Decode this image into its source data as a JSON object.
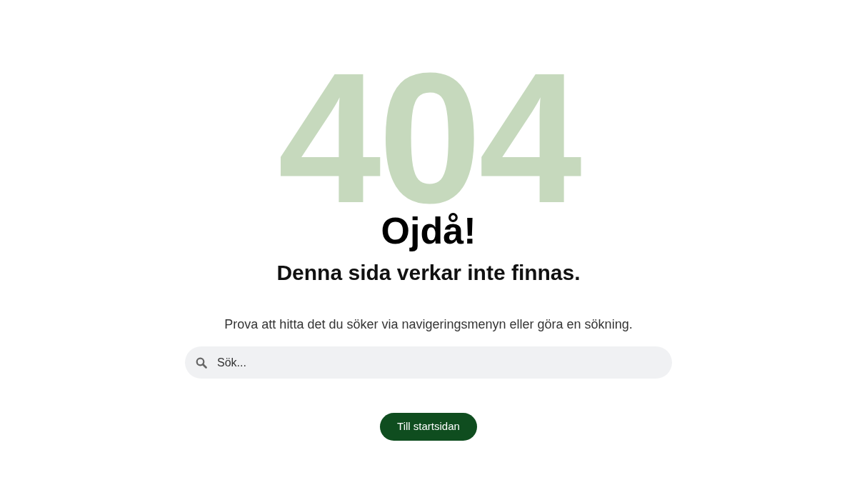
{
  "error_code": "404",
  "heading": "Ojdå!",
  "subheading": "Denna sida verkar inte finnas.",
  "message": "Prova att hitta det du söker via navigeringsmenyn eller göra en sökning.",
  "search": {
    "placeholder": "Sök..."
  },
  "button": "Till startsidan"
}
